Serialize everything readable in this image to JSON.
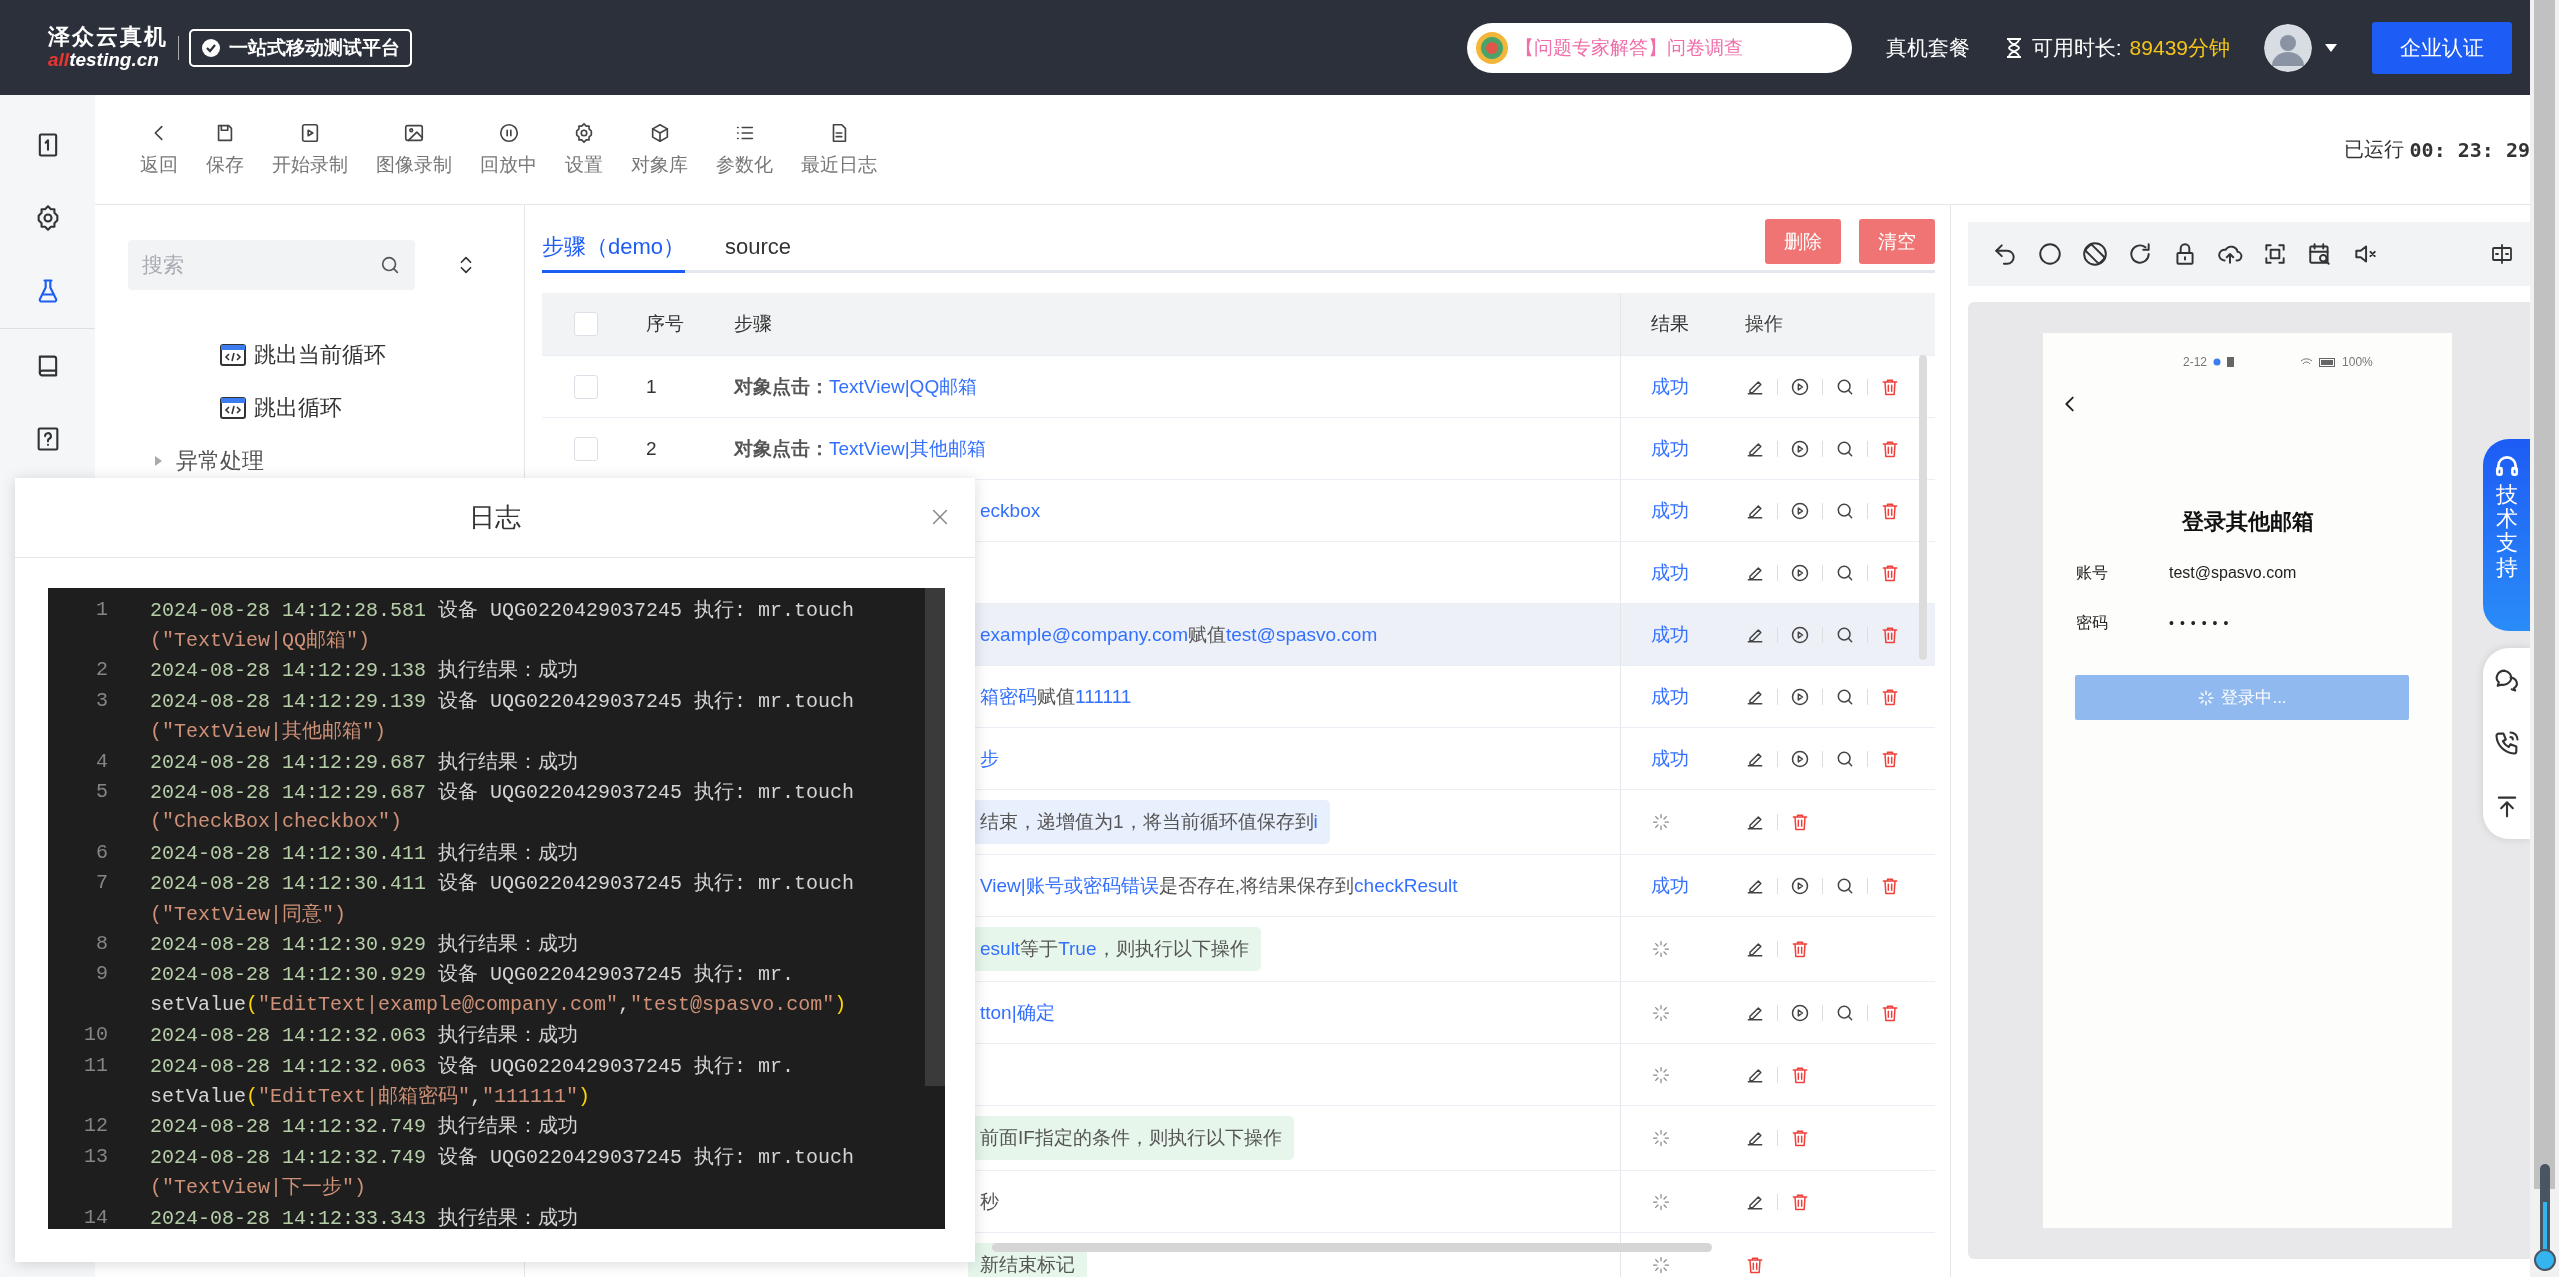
{
  "header": {
    "brand": "泽众云真机",
    "domain_accent": "all",
    "domain": "testing.cn",
    "slogan": "一站式移动测试平台",
    "survey": "【问题专家解答】问卷调查",
    "plan": "真机套餐",
    "time_label": "可用时长:",
    "time_value": "89439分钟",
    "cta": "企业认证"
  },
  "rail": [
    {
      "selected": false
    },
    {
      "selected": false
    },
    {
      "selected": true
    },
    {
      "selected": false
    },
    {
      "selected": false
    }
  ],
  "toolbar": {
    "items": [
      "返回",
      "保存",
      "开始录制",
      "图像录制",
      "回放中",
      "设置",
      "对象库",
      "参数化",
      "最近日志"
    ],
    "runtime_label": "已运行",
    "runtime": "00: 23: 29"
  },
  "tree": {
    "search_placeholder": "搜索",
    "nodes": [
      {
        "children": [
          {
            "label": "跳出当前循环"
          },
          {
            "label": "跳出循环"
          }
        ]
      },
      {
        "label": "异常处理",
        "expanded": false
      }
    ]
  },
  "steps": {
    "tabs": [
      {
        "label": "步骤（demo）",
        "selected": true
      },
      {
        "label": "source",
        "selected": false
      }
    ],
    "buttons": [
      "删除",
      "清空"
    ],
    "columns": [
      "序号",
      "步骤",
      "结果",
      "操作"
    ],
    "select_all": {
      "checked": false
    },
    "rows": [
      {
        "checked": false,
        "index": "1",
        "segments": [
          {
            "kind": "label",
            "text": "对象点击："
          },
          {
            "kind": "ref",
            "text": "TextView|QQ邮箱"
          }
        ],
        "running": false,
        "result": "成功",
        "kind": "action",
        "selected": false
      },
      {
        "checked": false,
        "index": "2",
        "segments": [
          {
            "kind": "label",
            "text": "对象点击："
          },
          {
            "kind": "ref",
            "text": "TextView|其他邮箱"
          }
        ],
        "running": false,
        "result": "成功",
        "kind": "action",
        "selected": false
      },
      {
        "segments": [
          {
            "kind": "ref",
            "text": "eckbox"
          }
        ],
        "running": false,
        "result": "成功",
        "kind": "action",
        "selected": false
      },
      {
        "running": false,
        "result": "成功",
        "kind": "action",
        "selected": false
      },
      {
        "segments": [
          {
            "kind": "ref",
            "text": "example@company.com"
          },
          {
            "kind": "plain",
            "text": "赋值"
          },
          {
            "kind": "ref",
            "text": "test@spasvo.com"
          }
        ],
        "running": false,
        "result": "成功",
        "kind": "action",
        "selected": true
      },
      {
        "segments": [
          {
            "kind": "ref",
            "text": "箱密码"
          },
          {
            "kind": "plain",
            "text": "赋值"
          },
          {
            "kind": "ref",
            "text": "111111"
          }
        ],
        "running": false,
        "result": "成功",
        "kind": "action",
        "selected": false
      },
      {
        "segments": [
          {
            "kind": "ref",
            "text": "步"
          }
        ],
        "running": false,
        "result": "成功",
        "kind": "action",
        "selected": false
      },
      {
        "segments": [
          {
            "kind": "plain",
            "text": "结束，递增值为1，将当前循环值保存到"
          },
          {
            "kind": "ref",
            "text": "i"
          }
        ],
        "color": "#e8effd",
        "running": true,
        "kind": "control",
        "selected": false
      },
      {
        "segments": [
          {
            "kind": "ref",
            "text": "View|账号或密码错误"
          },
          {
            "kind": "plain",
            "text": "是否存在,将结果保存到"
          },
          {
            "kind": "ref",
            "text": "checkResult"
          }
        ],
        "running": false,
        "result": "成功",
        "kind": "action",
        "selected": false
      },
      {
        "segments": [
          {
            "kind": "ref",
            "text": "esult"
          },
          {
            "kind": "plain",
            "text": "等于"
          },
          {
            "kind": "ref",
            "text": "True"
          },
          {
            "kind": "plain",
            "text": "，则执行以下操作"
          }
        ],
        "color": "#e7f6ea",
        "running": true,
        "kind": "control",
        "selected": false
      },
      {
        "segments": [
          {
            "kind": "ref",
            "text": "tton|确定"
          }
        ],
        "running": true,
        "kind": "action",
        "selected": false
      },
      {
        "running": true,
        "kind": "control",
        "selected": false
      },
      {
        "segments": [
          {
            "kind": "plain",
            "text": "前面IF指定的条件，则执行以下操作"
          }
        ],
        "color": "#e7f6ea",
        "running": true,
        "kind": "control",
        "selected": false
      },
      {
        "segments": [
          {
            "kind": "plain",
            "text": "秒"
          }
        ],
        "running": true,
        "kind": "control",
        "selected": false
      },
      {
        "segments": [
          {
            "kind": "plain",
            "text": "新结束标记"
          }
        ],
        "color": "#e7f6ea",
        "running": true,
        "kind": "tail",
        "selected": false
      }
    ]
  },
  "log": {
    "title": "日志",
    "entries": [
      {
        "no": "1",
        "time": "2024-08-28 14:12:28.581",
        "message": "设备 UQG0220429037245 执行: mr.touch",
        "continuation": [
          {
            "kind": "str",
            "text": "(\"TextView|QQ邮箱\")"
          }
        ]
      },
      {
        "no": "2",
        "time": "2024-08-28 14:12:29.138",
        "message": "执行结果：成功"
      },
      {
        "no": "3",
        "time": "2024-08-28 14:12:29.139",
        "message": "设备 UQG0220429037245 执行: mr.touch",
        "continuation": [
          {
            "kind": "str",
            "text": "(\"TextView|其他邮箱\")"
          }
        ]
      },
      {
        "no": "4",
        "time": "2024-08-28 14:12:29.687",
        "message": "执行结果：成功"
      },
      {
        "no": "5",
        "time": "2024-08-28 14:12:29.687",
        "message": "设备 UQG0220429037245 执行: mr.touch",
        "continuation": [
          {
            "kind": "str",
            "text": "(\"CheckBox|checkbox\")"
          }
        ]
      },
      {
        "no": "6",
        "time": "2024-08-28 14:12:30.411",
        "message": "执行结果：成功"
      },
      {
        "no": "7",
        "time": "2024-08-28 14:12:30.411",
        "message": "设备 UQG0220429037245 执行: mr.touch",
        "continuation": [
          {
            "kind": "str",
            "text": "(\"TextView|同意\")"
          }
        ]
      },
      {
        "no": "8",
        "time": "2024-08-28 14:12:30.929",
        "message": "执行结果：成功"
      },
      {
        "no": "9",
        "time": "2024-08-28 14:12:30.929",
        "message": "设备 UQG0220429037245 执行: mr.",
        "continuation": [
          {
            "kind": "text",
            "text": "setValue"
          },
          {
            "kind": "punc",
            "text": "("
          },
          {
            "kind": "str",
            "text": "\"EditText|example@company.com\""
          },
          {
            "kind": "text",
            "text": ","
          },
          {
            "kind": "str",
            "text": "\"test@spasvo.com\""
          },
          {
            "kind": "punc",
            "text": ")"
          }
        ]
      },
      {
        "no": "10",
        "time": "2024-08-28 14:12:32.063",
        "message": "执行结果：成功"
      },
      {
        "no": "11",
        "time": "2024-08-28 14:12:32.063",
        "message": "设备 UQG0220429037245 执行: mr.",
        "continuation": [
          {
            "kind": "text",
            "text": "setValue"
          },
          {
            "kind": "punc",
            "text": "("
          },
          {
            "kind": "str",
            "text": "\"EditText|邮箱密码\""
          },
          {
            "kind": "text",
            "text": ","
          },
          {
            "kind": "str",
            "text": "\"111111\""
          },
          {
            "kind": "punc",
            "text": ")"
          }
        ]
      },
      {
        "no": "12",
        "time": "2024-08-28 14:12:32.749",
        "message": "执行结果：成功"
      },
      {
        "no": "13",
        "time": "2024-08-28 14:12:32.749",
        "message": "设备 UQG0220429037245 执行: mr.touch",
        "continuation": [
          {
            "kind": "str",
            "text": "(\"TextView|下一步\")"
          }
        ]
      },
      {
        "no": "14",
        "time": "2024-08-28 14:12:33.343",
        "message": "执行结果：成功"
      }
    ]
  },
  "device": {
    "status_time": "2-12",
    "battery": "100%",
    "title": "登录其他邮箱",
    "fields": [
      {
        "label": "账号",
        "value": "test@spasvo.com"
      },
      {
        "label": "密码",
        "value": "••••••"
      }
    ],
    "button": "登录中..."
  },
  "support": {
    "label": "技术支持"
  }
}
